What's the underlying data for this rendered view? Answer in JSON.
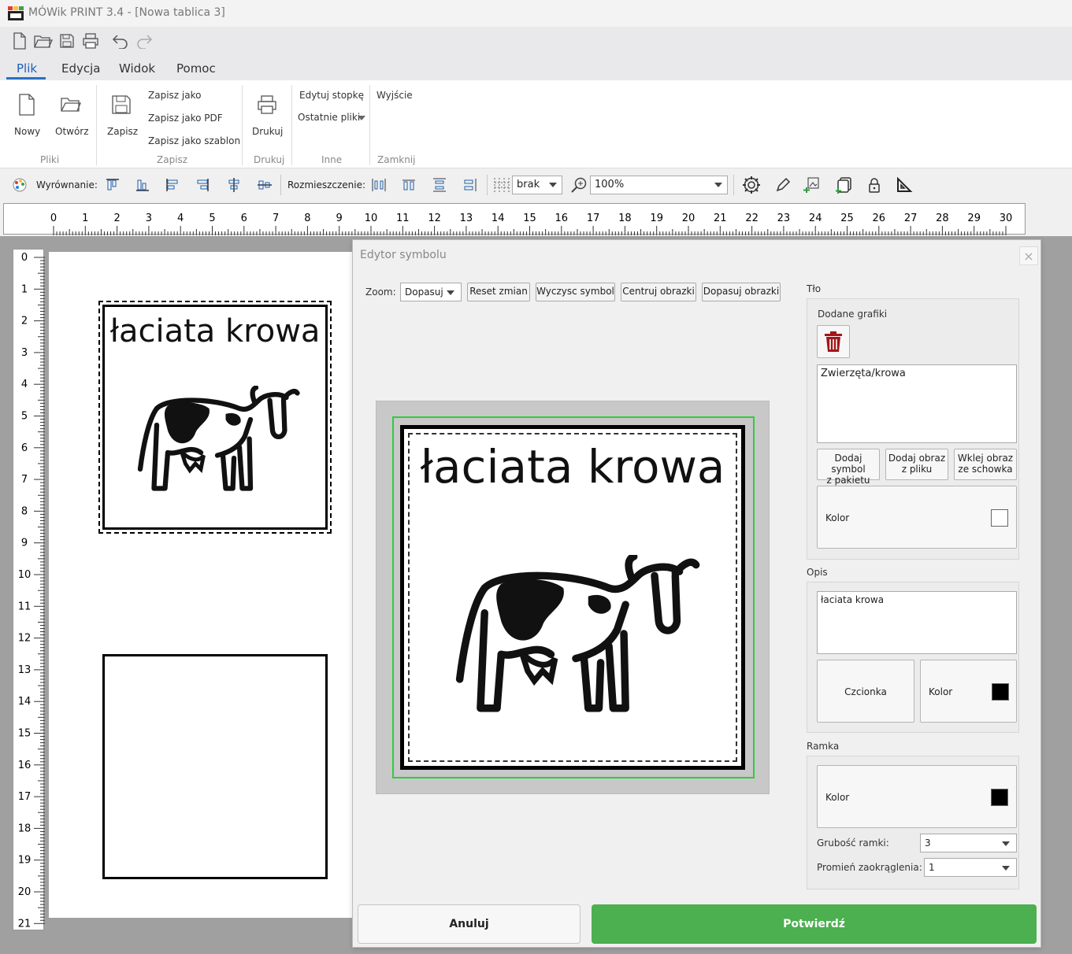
{
  "window": {
    "title": "MÓWik PRINT 3.4 - [Nowa tablica 3]"
  },
  "quick_access": [
    "new-doc-icon",
    "open-folder-icon",
    "save-icon",
    "print-icon",
    "undo-icon",
    "redo-icon"
  ],
  "menu": {
    "tabs": [
      "Plik",
      "Edycja",
      "Widok",
      "Pomoc"
    ],
    "active": "Plik"
  },
  "ribbon": {
    "new_label": "Nowy",
    "open_label": "Otwórz",
    "files_group": "Pliki",
    "save_label": "Zapisz",
    "save_as_label": "Zapisz jako",
    "save_pdf_label": "Zapisz jako PDF",
    "save_template_label": "Zapisz jako szablon",
    "save_group": "Zapisz",
    "print_label": "Drukuj",
    "print_group": "Drukuj",
    "edit_footer_label": "Edytuj stopkę",
    "recent_files_label": "Ostatnie pliki",
    "other_group": "Inne",
    "exit_label": "Wyjście",
    "close_group": "Zamknij"
  },
  "toolbar": {
    "alignment_label": "Wyrównanie:",
    "distribution_label": "Rozmieszczenie:",
    "grid_value": "brak",
    "zoom_value": "100%"
  },
  "ruler": {
    "h_numbers": [
      "0",
      "1",
      "2",
      "3",
      "4",
      "5",
      "6",
      "7",
      "8",
      "9",
      "10",
      "11",
      "12",
      "13",
      "14",
      "15",
      "16",
      "17",
      "18",
      "19",
      "20",
      "21",
      "22",
      "23",
      "24",
      "25",
      "26",
      "27",
      "28",
      "29",
      "30"
    ],
    "v_numbers": [
      "0",
      "1",
      "2",
      "3",
      "4",
      "5",
      "6",
      "7",
      "8",
      "9",
      "10",
      "11",
      "12",
      "13",
      "14",
      "15",
      "16",
      "17",
      "18",
      "19",
      "20",
      "21"
    ]
  },
  "canvas": {
    "symbol1_text": "łaciata krowa"
  },
  "dialog": {
    "title": "Edytor symbolu",
    "close_glyph": "×",
    "zoom_label": "Zoom:",
    "zoom_value": "Dopasuj",
    "reset_label": "Reset zmian",
    "clear_label": "Wyczysc symbol",
    "center_label": "Centruj obrazki",
    "fit_label": "Dopasuj obrazki",
    "preview_text": "łaciata krowa",
    "background_section": "Tło",
    "added_graphics_label": "Dodane grafiki",
    "graphics_list": [
      "Zwierzęta/krowa"
    ],
    "add_from_package_1": "Dodaj symbol",
    "add_from_package_2": "z pakietu",
    "add_from_file_1": "Dodaj obraz",
    "add_from_file_2": "z pliku",
    "paste_1": "Wklej obraz",
    "paste_2": "ze schowka",
    "bg_color_label": "Kolor",
    "bg_color": "#ffffff",
    "description_section": "Opis",
    "description_text": "łaciata krowa",
    "font_label": "Czcionka",
    "text_color_label": "Kolor",
    "text_color": "#000000",
    "frame_section": "Ramka",
    "frame_color_label": "Kolor",
    "frame_color": "#000000",
    "frame_thickness_label": "Grubość ramki:",
    "frame_thickness_value": "3",
    "corner_radius_label": "Promień zaokrąglenia:",
    "corner_radius_value": "1",
    "cancel_label": "Anuluj",
    "confirm_label": "Potwierdź",
    "confirm_color": "#4caf50"
  }
}
